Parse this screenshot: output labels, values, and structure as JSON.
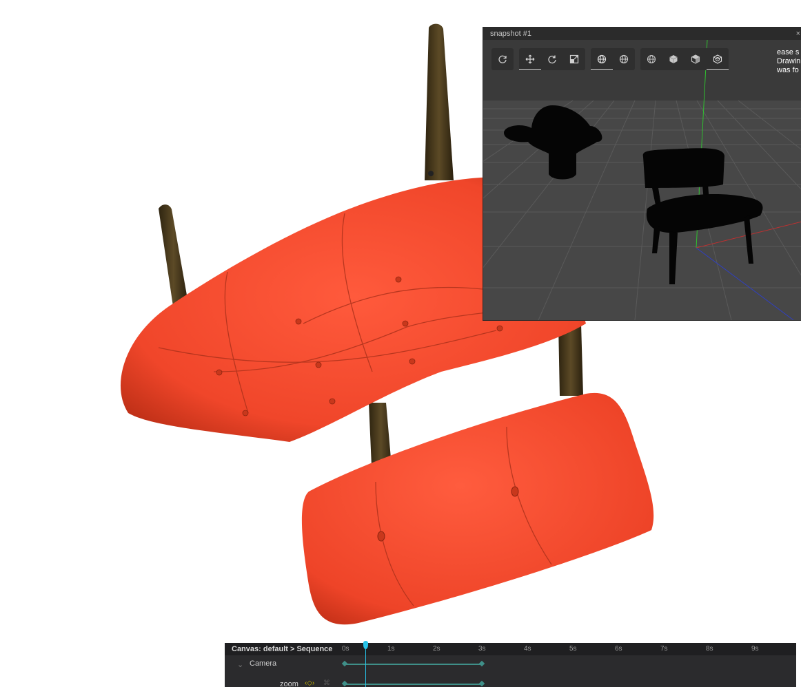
{
  "snapshot_window": {
    "title": "snapshot #1",
    "close_glyph": "×",
    "side_text_lines": [
      "ease s",
      "Drawin",
      "was fo"
    ],
    "toolbar": {
      "group1": [
        {
          "icon": "refresh-icon"
        }
      ],
      "group2": [
        {
          "icon": "move-icon",
          "active": true
        },
        {
          "icon": "rotate-icon"
        },
        {
          "icon": "scale-icon"
        }
      ],
      "group3": [
        {
          "icon": "globe-icon",
          "active": true
        },
        {
          "icon": "globe-alt-icon"
        }
      ],
      "group4": [
        {
          "icon": "wireframe-sphere-icon"
        },
        {
          "icon": "solid-cube-icon"
        },
        {
          "icon": "shaded-cube-icon"
        },
        {
          "icon": "textured-cube-icon",
          "active": true
        }
      ]
    }
  },
  "timeline": {
    "breadcrumb": "Canvas: default > Sequence",
    "ticks": [
      "0s",
      "1s",
      "2s",
      "3s",
      "4s",
      "5s",
      "6s",
      "7s",
      "8s",
      "9s"
    ],
    "tracks": [
      {
        "label": "Camera"
      },
      {
        "label": "zoom"
      }
    ],
    "colors": {
      "keyframe": "#3f8f88",
      "playhead": "#27c3e8"
    }
  }
}
